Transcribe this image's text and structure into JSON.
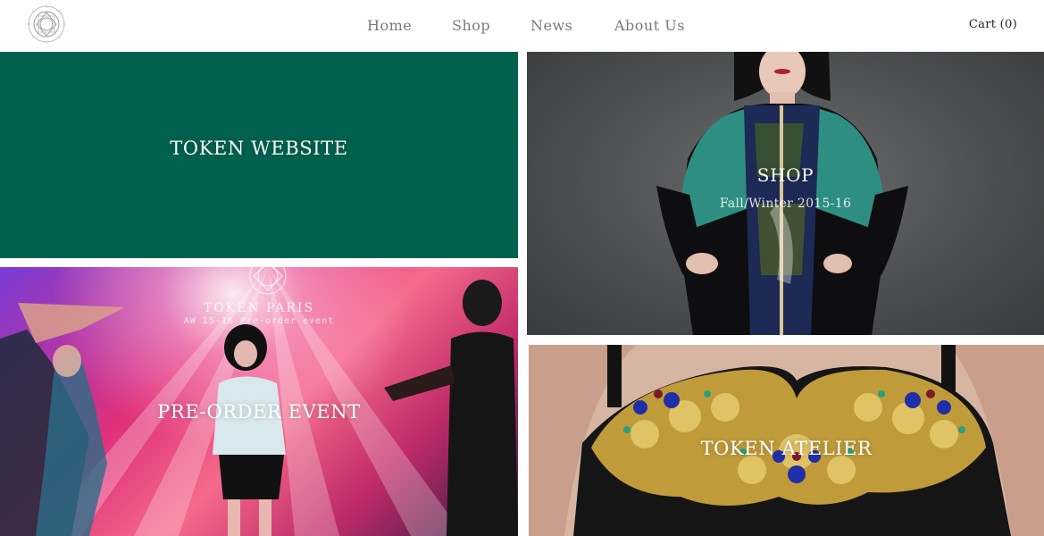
{
  "header": {
    "logo_alt": "TOKEN",
    "nav": [
      {
        "label": "Home"
      },
      {
        "label": "Shop"
      },
      {
        "label": "News"
      },
      {
        "label": "About Us"
      }
    ],
    "cart_label": "Cart (0)"
  },
  "tiles": {
    "website": {
      "title": "TOKEN WEBSITE",
      "color": "#00614f"
    },
    "shop": {
      "title": "SHOP",
      "subtitle": "Fall/Winter 2015-16"
    },
    "event": {
      "title": "PRE-ORDER EVENT",
      "brand": "TOKEN PARIS",
      "brand_sub": "AW 15-16 Pre-order event"
    },
    "atelier": {
      "title": "TOKEN ATELIER"
    }
  },
  "colors": {
    "teal": "#00614f",
    "nav_text": "#7a7a7a"
  }
}
